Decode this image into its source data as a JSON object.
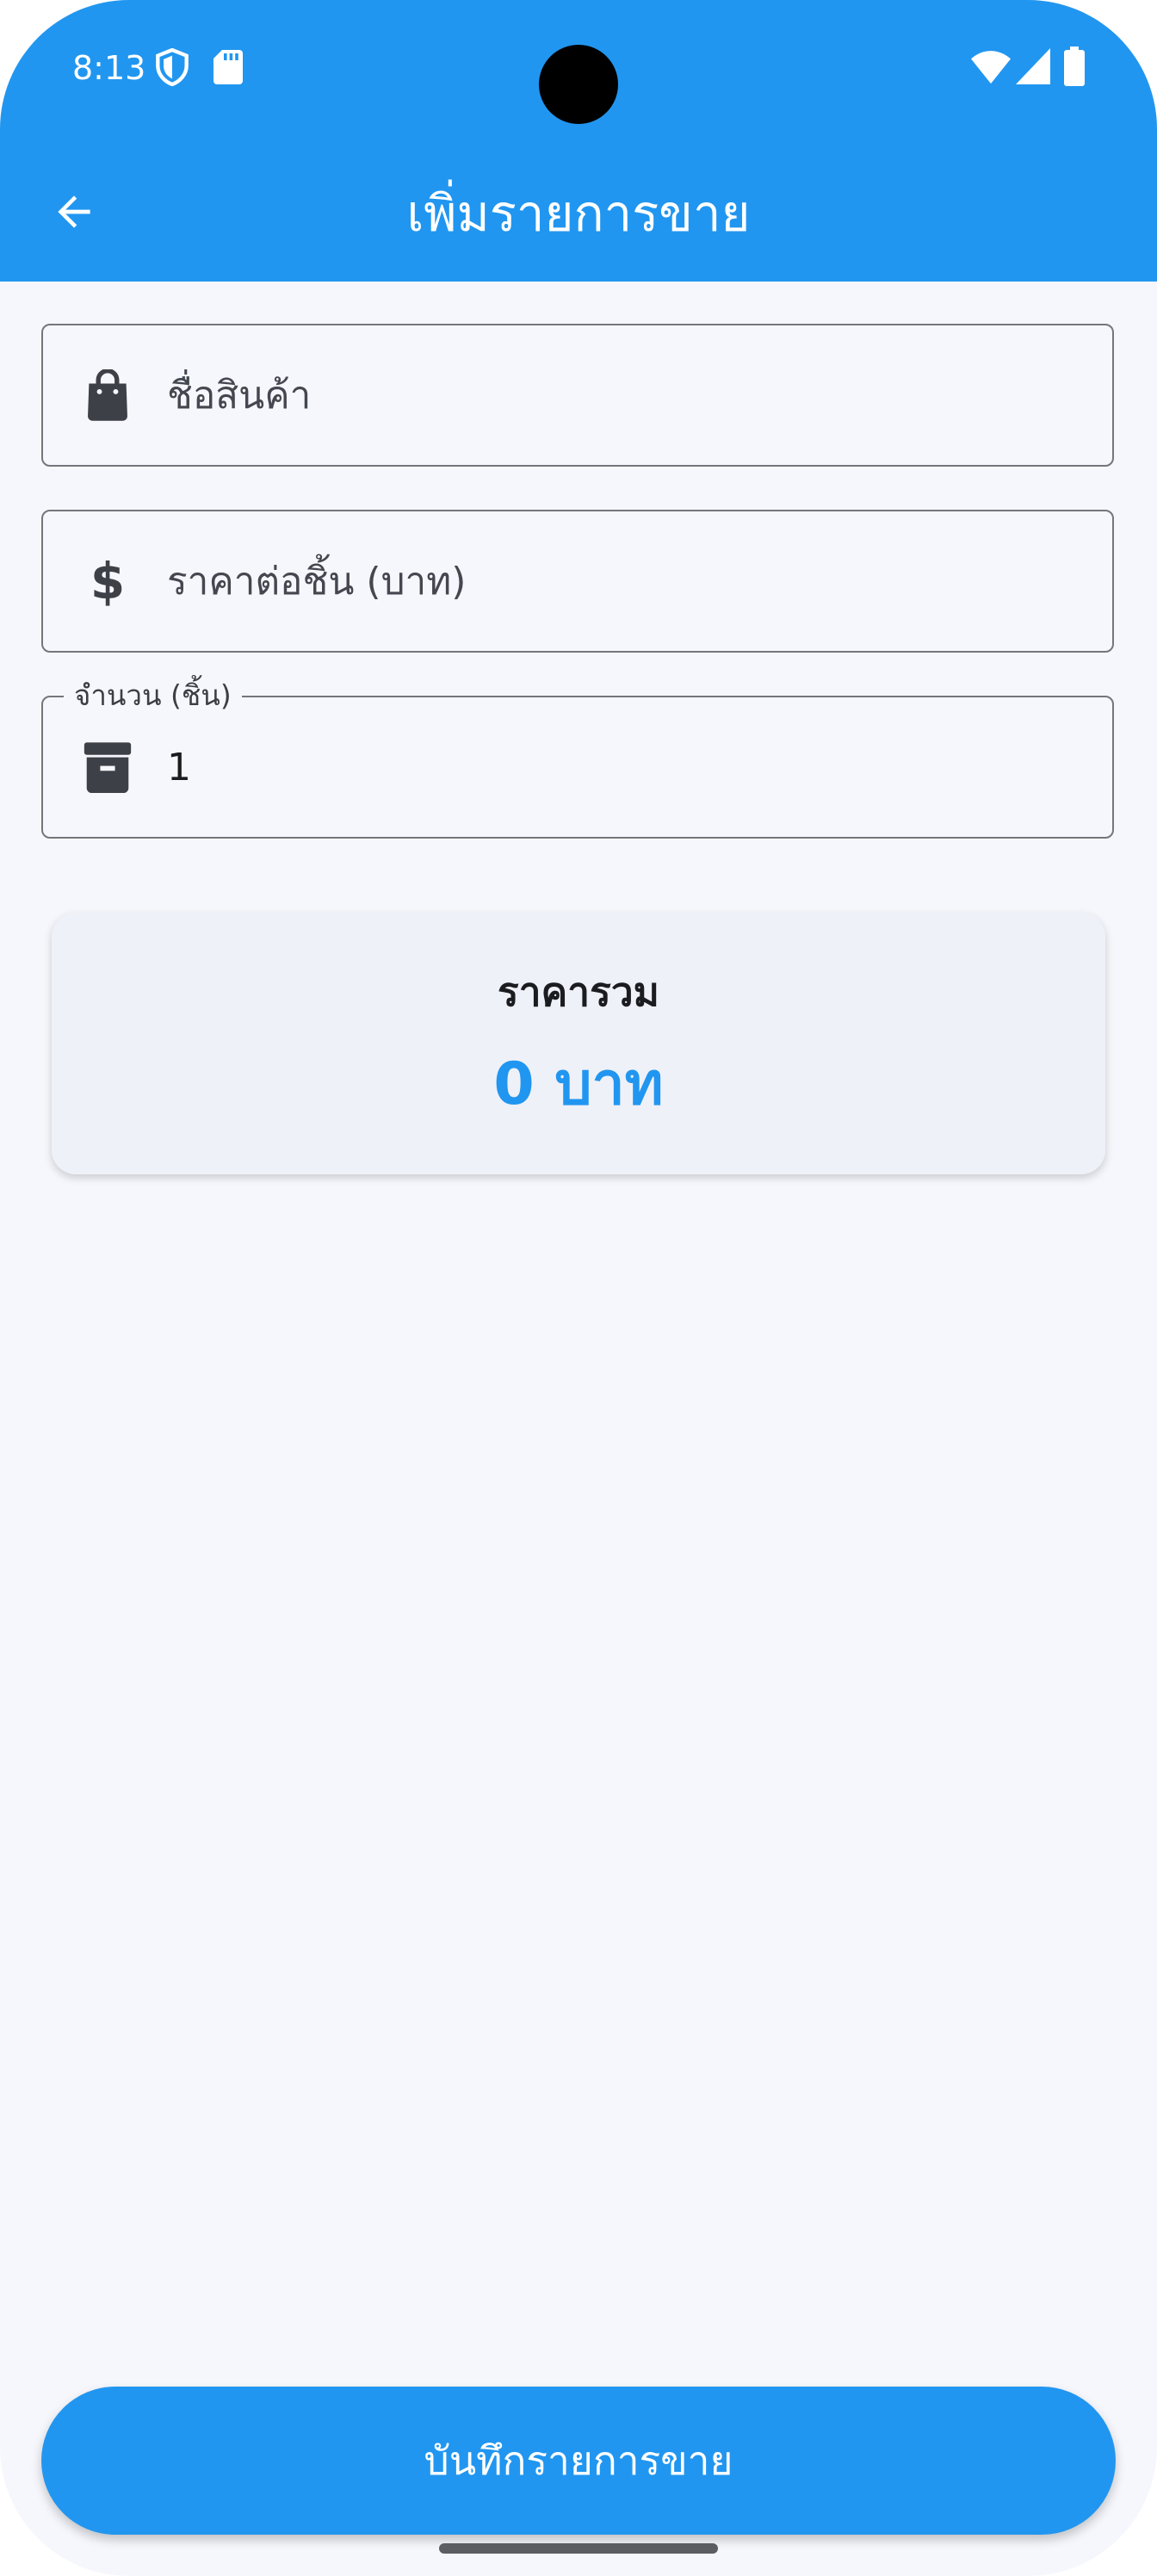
{
  "status_bar": {
    "time": "8:13",
    "icons": [
      "shield-icon",
      "sd-card-icon",
      "wifi-icon",
      "signal-icon",
      "battery-icon"
    ]
  },
  "app_bar": {
    "title": "เพิ่มรายการขาย",
    "back_icon": "arrow-back-icon",
    "color": "#2196f0"
  },
  "form": {
    "product_name": {
      "placeholder": "ชื่อสินค้า",
      "icon": "shopping-bag-icon"
    },
    "unit_price": {
      "placeholder": "ราคาต่อชิ้น (บาท)",
      "icon": "dollar-icon",
      "icon_glyph": "$"
    },
    "quantity": {
      "label": "จำนวน (ชิ้น)",
      "value": "1",
      "icon": "archive-box-icon"
    }
  },
  "total": {
    "label": "ราคารวม",
    "value": "0 บาท",
    "value_color": "#2196f0"
  },
  "save_button": {
    "label": "บันทึกรายการขาย"
  }
}
